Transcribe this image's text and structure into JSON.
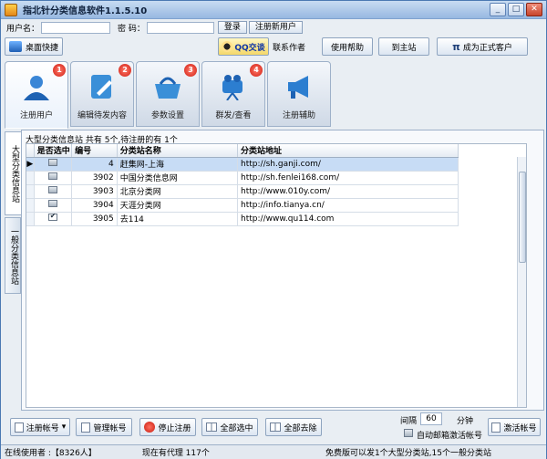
{
  "window": {
    "title": "指北针分类信息软件1.1.5.10",
    "controls": [
      "_",
      "□",
      "✕"
    ]
  },
  "login": {
    "username_label": "用户名：",
    "password_label": "密 码：",
    "login_button": "登录",
    "register_button": "注册新用户"
  },
  "toolbar": {
    "desktop_shortcut": "桌面快捷",
    "qq_chat": "QQ交谈",
    "contact_author": "联系作者",
    "help": "使用帮助",
    "goto_site": "到主站",
    "become_customer": "成为正式客户",
    "pi_symbol": "π"
  },
  "tabs": [
    {
      "label": "注册用户",
      "badge": "1",
      "icon": "user-icon"
    },
    {
      "label": "编辑待发内容",
      "badge": "2",
      "icon": "edit-icon"
    },
    {
      "label": "参数设置",
      "badge": "3",
      "icon": "basket-icon"
    },
    {
      "label": "群发/查看",
      "badge": "4",
      "icon": "broadcast-icon"
    },
    {
      "label": "注册辅助",
      "badge": "",
      "icon": "megaphone-icon"
    }
  ],
  "side_tabs": [
    "大型分类信息站",
    "一般分类信息站"
  ],
  "grid": {
    "info": "大型分类信息站 共有 5个,待注册的有 1个",
    "columns": [
      "是否选中",
      "编号",
      "分类站名称",
      "分类站地址"
    ],
    "rows": [
      {
        "selected": false,
        "checked": false,
        "id": "4",
        "name": "赶集网-上海",
        "url": "http://sh.ganji.com/"
      },
      {
        "selected": false,
        "checked": false,
        "id": "3902",
        "name": "中国分类信息网",
        "url": "http://sh.fenlei168.com/"
      },
      {
        "selected": false,
        "checked": false,
        "id": "3903",
        "name": "北京分类网",
        "url": "http://www.010y.com/"
      },
      {
        "selected": false,
        "checked": false,
        "id": "3904",
        "name": "天涯分类网",
        "url": "http://info.tianya.cn/"
      },
      {
        "selected": false,
        "checked": true,
        "id": "3905",
        "name": "去114",
        "url": "http://www.qu114.com"
      }
    ]
  },
  "actions": {
    "register_account": "注册帐号",
    "manage_accounts": "管理帐号",
    "stop_register": "停止注册",
    "select_all": "全部选中",
    "remove_all": "全部去除",
    "interval_label": "间隔",
    "interval_value": "60",
    "interval_unit": "分钟",
    "auto_activate": "自动邮箱激活帐号",
    "activate_account": "激活帐号"
  },
  "status": {
    "online_users": "在线使用者 :【8326人】",
    "agents": "现在有代理 117个",
    "notice": "免费版可以发1个大型分类站,15个一般分类站"
  }
}
